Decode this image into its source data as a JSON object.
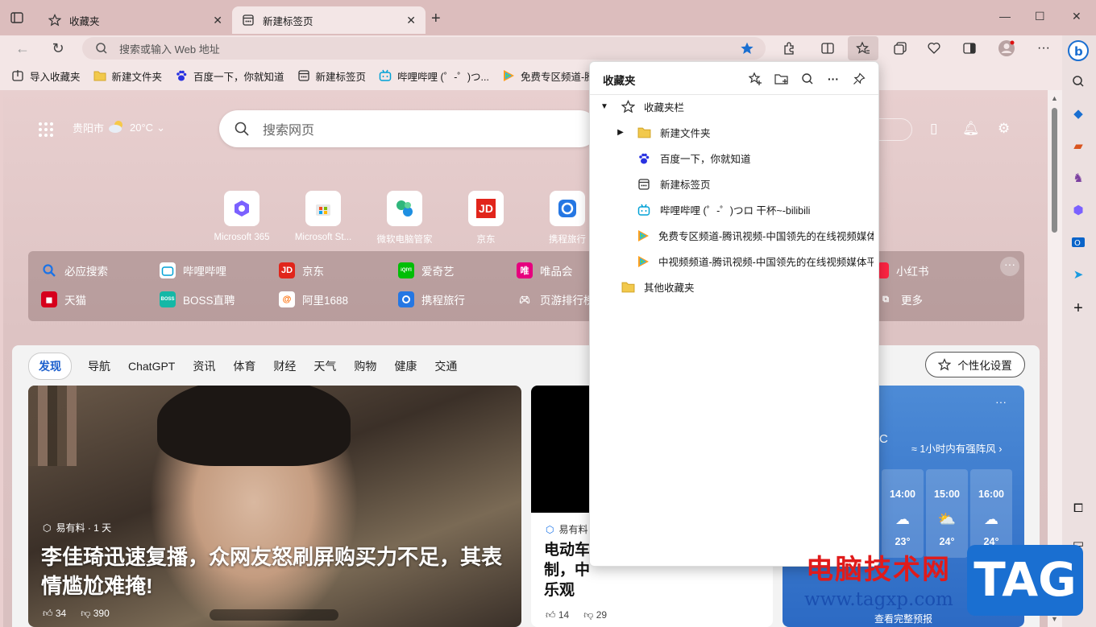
{
  "tabs": [
    {
      "title": "收藏夹",
      "close": "✕"
    },
    {
      "title": "新建标签页",
      "close": "✕"
    }
  ],
  "toolbar": {
    "address_placeholder": "搜索或输入 Web 地址"
  },
  "favorites_bar": [
    {
      "label": "导入收藏夹",
      "icon": "import-icon"
    },
    {
      "label": "新建文件夹",
      "icon": "folder-icon"
    },
    {
      "label": "百度一下，你就知道",
      "icon": "baidu-icon"
    },
    {
      "label": "新建标签页",
      "icon": "newtab-icon"
    },
    {
      "label": "哔哩哔哩 (゜-゜)つ...",
      "icon": "bilibili-icon"
    },
    {
      "label": "免费专区频道-腾讯",
      "icon": "tencent-video-icon"
    }
  ],
  "newtab": {
    "location": "贵阳市",
    "temperature": "20°C",
    "search_placeholder": "搜索网页",
    "quick_tiles": [
      {
        "label": "Microsoft 365"
      },
      {
        "label": "Microsoft St..."
      },
      {
        "label": "微软电脑管家"
      },
      {
        "label": "京东",
        "badge": "JD"
      },
      {
        "label": "携程旅行"
      }
    ],
    "links_row1": [
      {
        "label": "必应搜索"
      },
      {
        "label": "哔哩哔哩"
      },
      {
        "label": "京东",
        "badge": "JD"
      },
      {
        "label": "爱奇艺",
        "badge": "iQIYI"
      },
      {
        "label": "唯品会",
        "badge": "唯"
      },
      {
        "label": "小红书"
      }
    ],
    "links_row2": [
      {
        "label": "天猫"
      },
      {
        "label": "BOSS直聘",
        "badge": "BOSS"
      },
      {
        "label": "阿里1688"
      },
      {
        "label": "携程旅行"
      },
      {
        "label": "页游排行榜"
      },
      {
        "label": "更多"
      }
    ],
    "more_dots": "···"
  },
  "feed": {
    "tabs": [
      "发现",
      "导航",
      "ChatGPT",
      "资讯",
      "体育",
      "财经",
      "天气",
      "购物",
      "健康",
      "交通"
    ],
    "personalize": "个性化设置",
    "hero": {
      "source": "易有料 · 1 天",
      "headline": "李佳琦迅速复播，众网友怒刷屏购买力不足，其表情尴尬难掩!",
      "likes": "34",
      "dislikes": "390"
    },
    "card2": {
      "source": "易有料",
      "headline_line1": "电动车",
      "headline_line2": "制，中",
      "headline_line3": "乐观",
      "likes": "14",
      "dislikes": "29"
    },
    "weather": {
      "more": "···",
      "unit": "C",
      "alert": "1小时内有强阵风",
      "hours": [
        {
          "time": "14:00",
          "temp": "23°"
        },
        {
          "time": "15:00",
          "temp": "24°"
        },
        {
          "time": "16:00",
          "temp": "24°"
        }
      ],
      "footer": "查看完整预报"
    }
  },
  "favorites_panel": {
    "title": "收藏夹",
    "items": [
      {
        "label": "收藏夹栏",
        "icon": "star-outline-icon",
        "level": 0,
        "caret": "▼"
      },
      {
        "label": "新建文件夹",
        "icon": "folder-icon",
        "level": 1,
        "caret": "▶"
      },
      {
        "label": "百度一下，你就知道",
        "icon": "baidu-icon",
        "level": 1,
        "caret": ""
      },
      {
        "label": "新建标签页",
        "icon": "newtab-icon",
        "level": 1,
        "caret": ""
      },
      {
        "label": "哔哩哔哩 (゜-゜)つロ 干杯~-bilibili",
        "icon": "bilibili-icon",
        "level": 1,
        "caret": ""
      },
      {
        "label": "免费专区频道-腾讯视频-中国领先的在线视频媒体平",
        "icon": "tencent-video-icon",
        "level": 1,
        "caret": ""
      },
      {
        "label": "中视频频道-腾讯视频-中国领先的在线视频媒体平台",
        "icon": "tencent-video-icon",
        "level": 1,
        "caret": ""
      },
      {
        "label": "其他收藏夹",
        "icon": "folder-icon",
        "level": 0,
        "caret": ""
      }
    ]
  },
  "watermark": {
    "cn": "电脑技术网",
    "url": "www.tagxp.com",
    "tag": "TAG"
  },
  "colors": {
    "frame": "#dcbdbd",
    "toolbar": "#f3e6e6",
    "accent": "#1a5ecc",
    "favorite_star": "#1a6fd1"
  }
}
